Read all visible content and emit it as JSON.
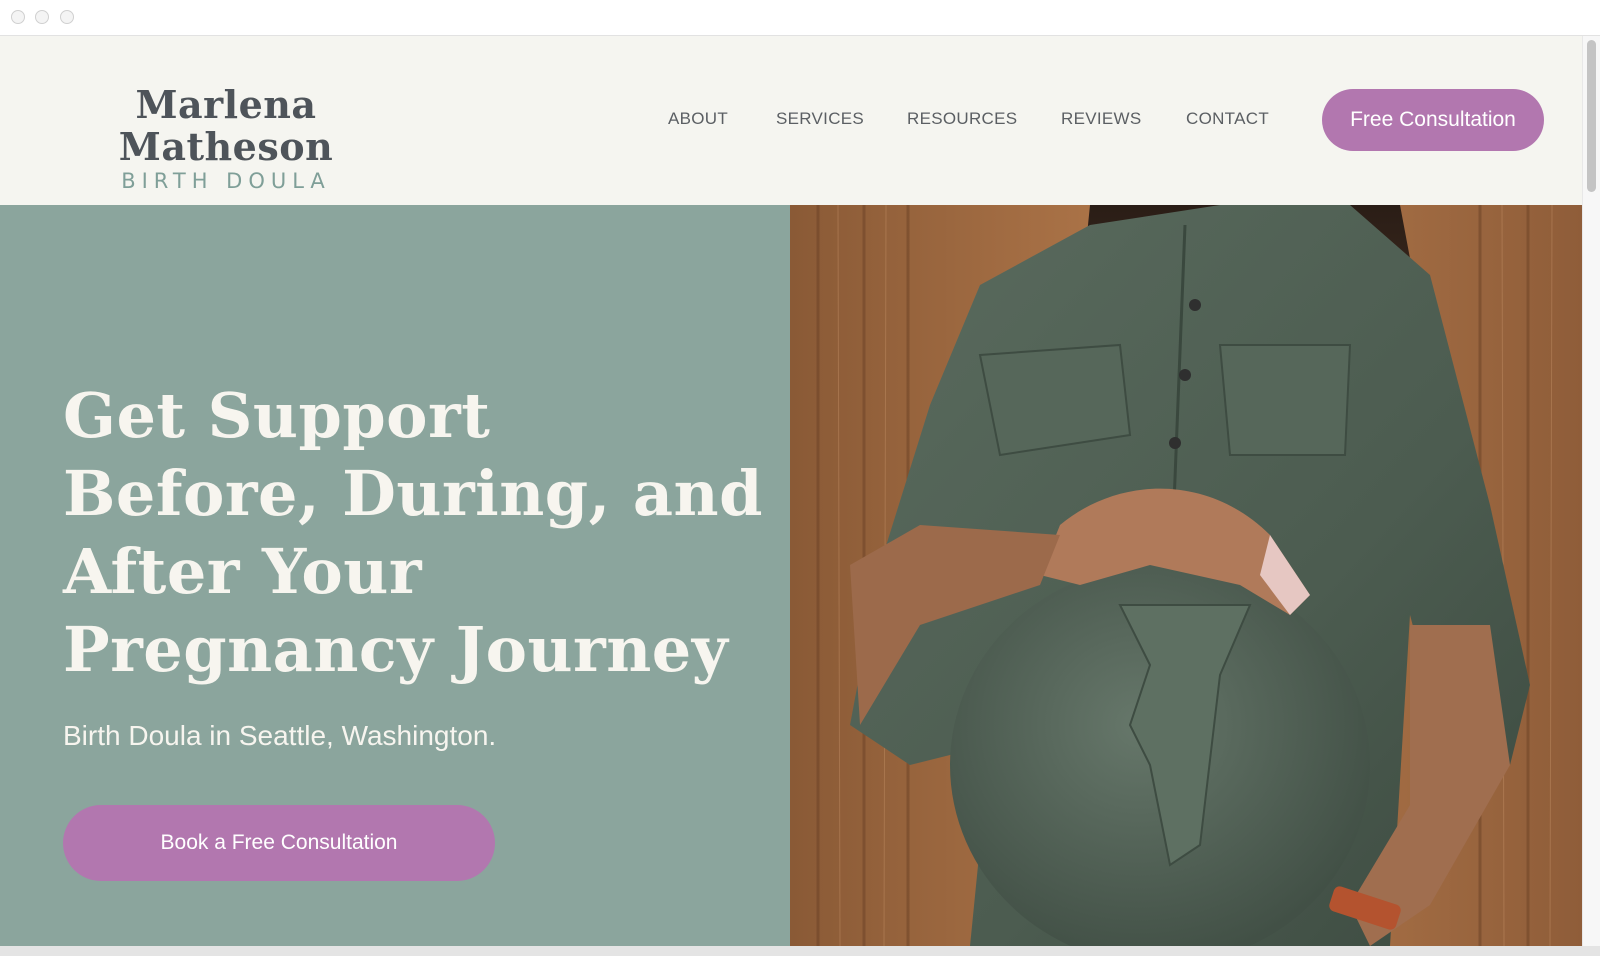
{
  "window": {
    "controls": [
      "close",
      "minimize",
      "zoom"
    ]
  },
  "header": {
    "logo_name": "Marlena Matheson",
    "logo_subtitle": "BIRTH DOULA",
    "nav": [
      {
        "label": "ABOUT"
      },
      {
        "label": "SERVICES"
      },
      {
        "label": "RESOURCES"
      },
      {
        "label": "REVIEWS"
      },
      {
        "label": "CONTACT"
      }
    ],
    "cta_label": "Free Consultation"
  },
  "hero": {
    "title": "Get Support Before, During, and After Your Pregnancy Journey",
    "subtitle": "Birth Doula in Seattle, Washington.",
    "cta_label": "Book a Free Consultation",
    "image_icon": "pregnant-woman-photo"
  },
  "colors": {
    "page_background": "#f5f5f0",
    "hero_panel": "#8ba59d",
    "accent_button": "#b277af",
    "logo_text": "#4e545a",
    "logo_subtitle": "#7f9f98",
    "hero_text": "#f7f5ef"
  }
}
